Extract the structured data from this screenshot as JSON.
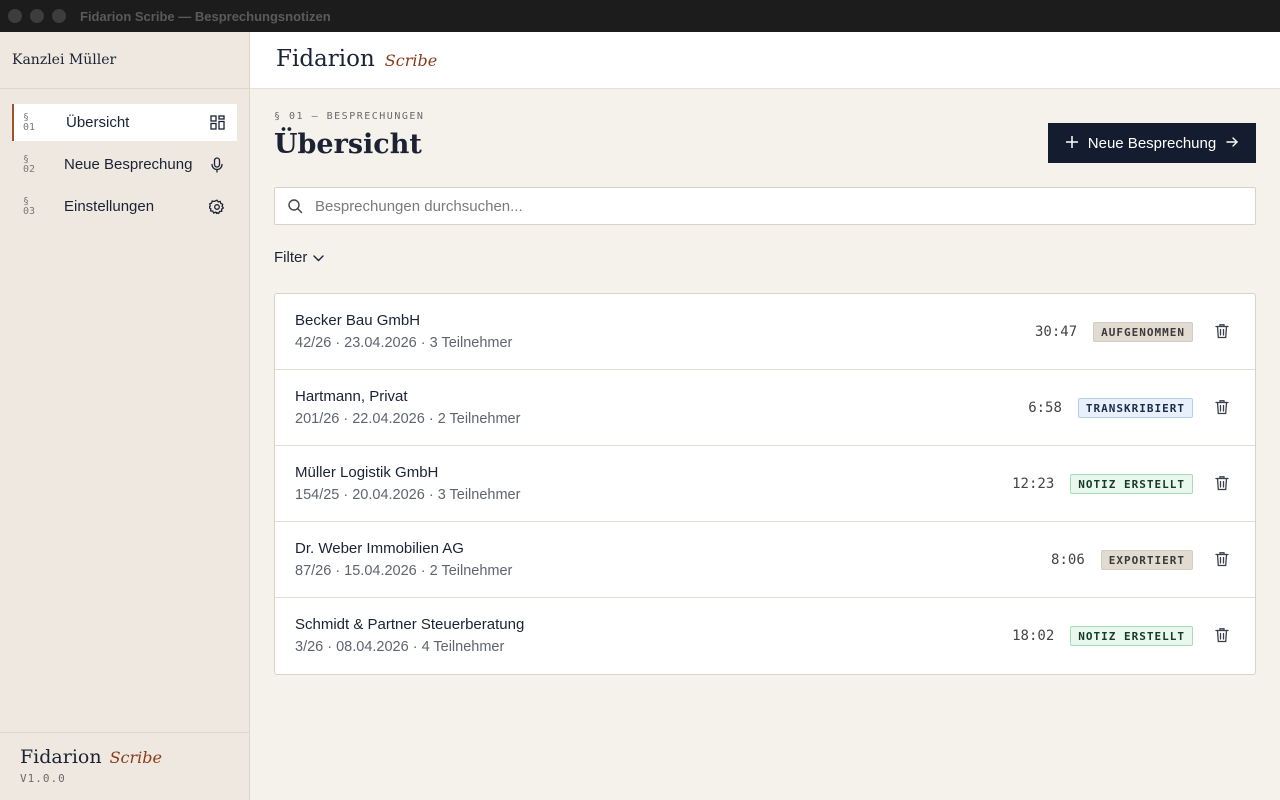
{
  "window": {
    "title": "Fidarion Scribe — Besprechungsnotizen"
  },
  "sidebar": {
    "firm_name": "Kanzlei Müller",
    "items": [
      {
        "num_a": "§",
        "num_b": "01",
        "label": "Übersicht",
        "icon": "dashboard-icon",
        "active": true
      },
      {
        "num_a": "§",
        "num_b": "02",
        "label": "Neue Besprechung",
        "icon": "microphone-icon",
        "active": false
      },
      {
        "num_a": "§",
        "num_b": "03",
        "label": "Einstellungen",
        "icon": "gear-icon",
        "active": false
      }
    ],
    "footer": {
      "brand_main": "Fidarion",
      "brand_sub": "Scribe",
      "version": "V1.0.0"
    }
  },
  "header": {
    "brand_main": "Fidarion",
    "brand_sub": "Scribe"
  },
  "main": {
    "eyebrow": "§ 01 — BESPRECHUNGEN",
    "title": "Übersicht",
    "new_button_label": "Neue Besprechung",
    "search_placeholder": "Besprechungen durchsuchen...",
    "filter_label": "Filter",
    "meetings": [
      {
        "name": "Becker Bau GmbH",
        "meta": "42/26 · 23.04.2026 · 3 Teilnehmer",
        "duration": "30:47",
        "status": "AUFGENOMMEN",
        "status_kind": "rec"
      },
      {
        "name": "Hartmann, Privat",
        "meta": "201/26 · 22.04.2026 · 2 Teilnehmer",
        "duration": "6:58",
        "status": "TRANSKRIBIERT",
        "status_kind": "tr"
      },
      {
        "name": "Müller Logistik GmbH",
        "meta": "154/25 · 20.04.2026 · 3 Teilnehmer",
        "duration": "12:23",
        "status": "NOTIZ ERSTELLT",
        "status_kind": "note"
      },
      {
        "name": "Dr. Weber Immobilien AG",
        "meta": "87/26 · 15.04.2026 · 2 Teilnehmer",
        "duration": "8:06",
        "status": "EXPORTIERT",
        "status_kind": "exp"
      },
      {
        "name": "Schmidt & Partner Steuerberatung",
        "meta": "3/26 · 08.04.2026 · 4 Teilnehmer",
        "duration": "18:02",
        "status": "NOTIZ ERSTELLT",
        "status_kind": "note"
      }
    ]
  },
  "colors": {
    "accent": "#a0522d",
    "primary_button": "#141d30",
    "brand_sub": "#8b3a1a"
  }
}
